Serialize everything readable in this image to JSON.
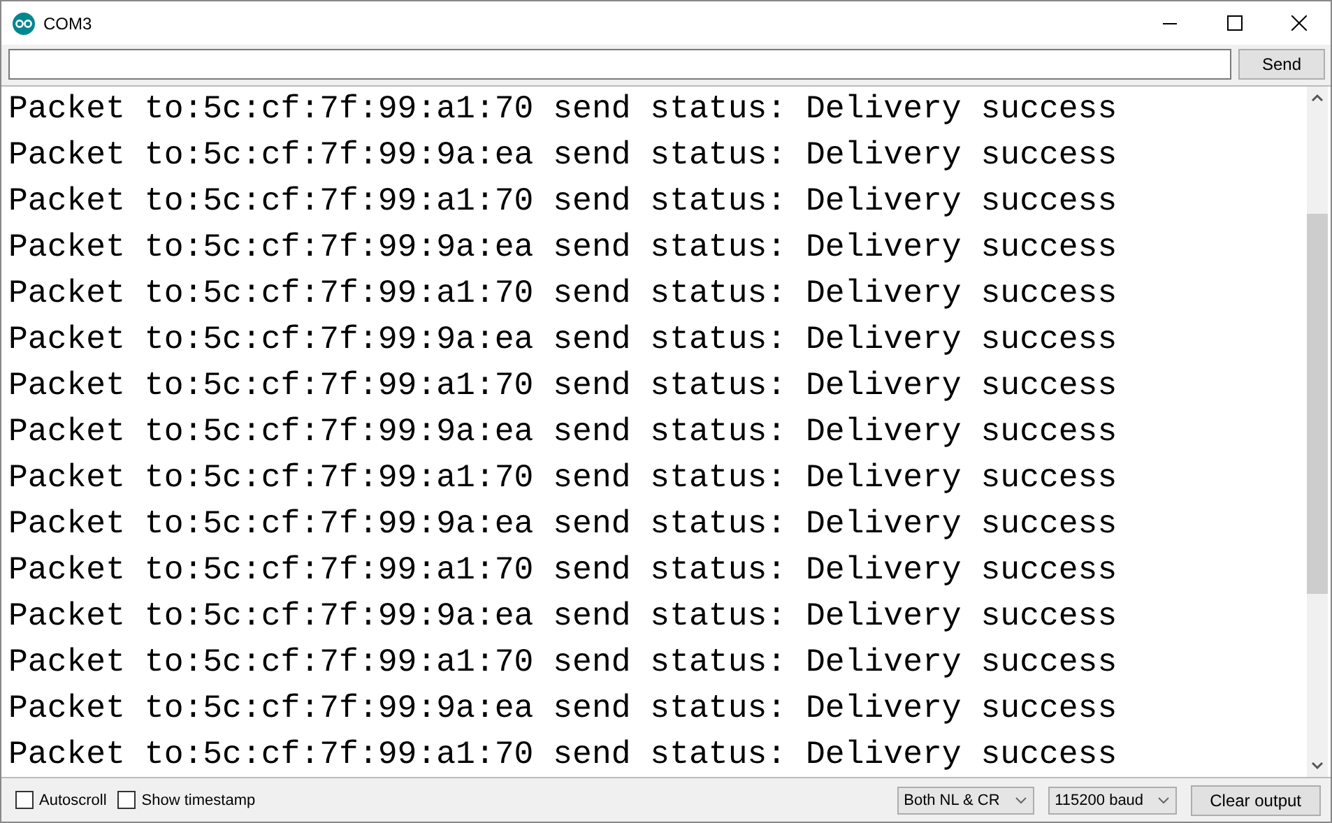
{
  "window": {
    "title": "COM3"
  },
  "send_button": "Send",
  "output_lines": [
    "Packet to:5c:cf:7f:99:a1:70 send status: Delivery success",
    "Packet to:5c:cf:7f:99:9a:ea send status: Delivery success",
    "Packet to:5c:cf:7f:99:a1:70 send status: Delivery success",
    "Packet to:5c:cf:7f:99:9a:ea send status: Delivery success",
    "Packet to:5c:cf:7f:99:a1:70 send status: Delivery success",
    "Packet to:5c:cf:7f:99:9a:ea send status: Delivery success",
    "Packet to:5c:cf:7f:99:a1:70 send status: Delivery success",
    "Packet to:5c:cf:7f:99:9a:ea send status: Delivery success",
    "Packet to:5c:cf:7f:99:a1:70 send status: Delivery success",
    "Packet to:5c:cf:7f:99:9a:ea send status: Delivery success",
    "Packet to:5c:cf:7f:99:a1:70 send status: Delivery success",
    "Packet to:5c:cf:7f:99:9a:ea send status: Delivery success",
    "Packet to:5c:cf:7f:99:a1:70 send status: Delivery success",
    "Packet to:5c:cf:7f:99:9a:ea send status: Delivery success",
    "Packet to:5c:cf:7f:99:a1:70 send status: Delivery success"
  ],
  "options": [
    {
      "label": "Autoscroll",
      "checked": false
    },
    {
      "label": "Show timestamp",
      "checked": false
    }
  ],
  "line_ending": "Both NL & CR",
  "baud_rate": "115200 baud",
  "clear_button": "Clear output"
}
